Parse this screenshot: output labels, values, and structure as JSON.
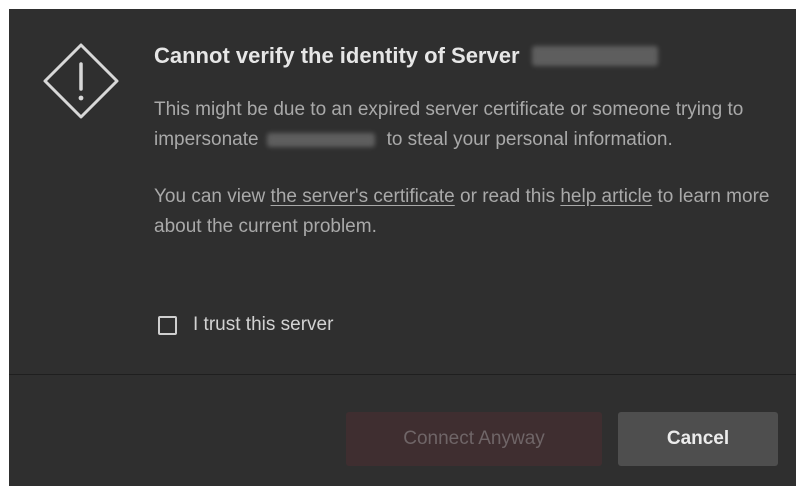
{
  "dialog": {
    "title": "Cannot verify the identity of Server",
    "paragraph1": {
      "before": "This might be due to an expired server certificate or someone trying to impersonate",
      "after": "to steal your personal information."
    },
    "paragraph2": {
      "text1": "You can view ",
      "certificate_link": "the server's certificate",
      "text2": " or read this ",
      "help_link": "help article",
      "text3": " to learn more about the current problem."
    },
    "trust_checkbox": {
      "label": "I trust this server",
      "checked": false
    },
    "buttons": {
      "connect_label": "Connect Anyway",
      "cancel_label": "Cancel"
    },
    "icon": "warning-diamond-icon"
  }
}
